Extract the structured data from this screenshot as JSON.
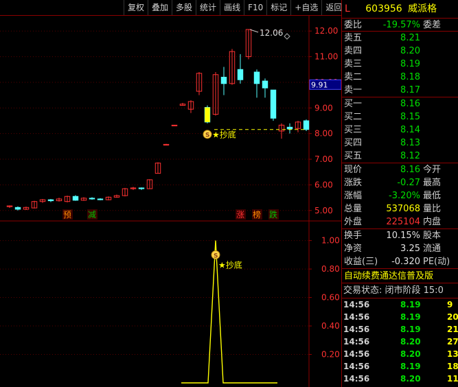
{
  "toolbar": [
    "复权",
    "叠加",
    "多股",
    "统计",
    "画线",
    "F10",
    "标记",
    "+自选",
    "返回"
  ],
  "stock": {
    "market": "L",
    "code": "603956",
    "name": "威派格"
  },
  "weibi": {
    "label": "委比",
    "value": "-19.57%",
    "label2": "委差"
  },
  "asks": [
    {
      "label": "卖五",
      "price": "8.21"
    },
    {
      "label": "卖四",
      "price": "8.20"
    },
    {
      "label": "卖三",
      "price": "8.19"
    },
    {
      "label": "卖二",
      "price": "8.18"
    },
    {
      "label": "卖一",
      "price": "8.17"
    }
  ],
  "bids": [
    {
      "label": "买一",
      "price": "8.16"
    },
    {
      "label": "买二",
      "price": "8.15"
    },
    {
      "label": "买三",
      "price": "8.14"
    },
    {
      "label": "买四",
      "price": "8.13"
    },
    {
      "label": "买五",
      "price": "8.12"
    }
  ],
  "quote": [
    {
      "label": "现价",
      "value": "8.16",
      "label2": "今开",
      "cls": "green"
    },
    {
      "label": "涨跌",
      "value": "-0.27",
      "label2": "最高",
      "cls": "green"
    },
    {
      "label": "涨幅",
      "value": "-3.20%",
      "label2": "最低",
      "cls": "green"
    },
    {
      "label": "总量",
      "value": "537068",
      "label2": "量比",
      "cls": "yellow"
    },
    {
      "label": "外盘",
      "value": "225104",
      "label2": "内盘",
      "cls": "red"
    }
  ],
  "finance": [
    {
      "label": "换手",
      "value": "10.15%",
      "label2": "股本"
    },
    {
      "label": "净资",
      "value": "3.25",
      "label2": "流通"
    },
    {
      "label": "收益(三)",
      "value": "-0.320",
      "label2": "PE(动)"
    }
  ],
  "banner": "自动续费通达信普及版",
  "trade_state": "交易状态: 闭市阶段 15:0",
  "ticks": [
    {
      "time": "14:56",
      "price": "8.19",
      "vol": "9"
    },
    {
      "time": "14:56",
      "price": "8.19",
      "vol": "20"
    },
    {
      "time": "14:56",
      "price": "8.19",
      "vol": "21"
    },
    {
      "time": "14:56",
      "price": "8.20",
      "vol": "27"
    },
    {
      "time": "14:56",
      "price": "8.20",
      "vol": "13"
    },
    {
      "time": "14:56",
      "price": "8.19",
      "vol": "18"
    },
    {
      "time": "14:56",
      "price": "8.20",
      "vol": "11"
    }
  ],
  "chart_data": [
    {
      "type": "candlestick",
      "y_axis_ticks": [
        "12.00",
        "11.00",
        "10.00",
        "9.00",
        "8.00",
        "7.00",
        "6.00",
        "5.00"
      ],
      "ylim": [
        4.7,
        12.3
      ],
      "current_price_label": "9.91",
      "max_annotation": "12.06",
      "signal_label": "★抄底",
      "signal_icon": "S",
      "event_markers": [
        {
          "text": "预",
          "color": "#ff8c00",
          "at": 7
        },
        {
          "text": "减",
          "color": "#00c000",
          "at": 10
        },
        {
          "text": "涨",
          "color": "#ff3232",
          "at": 28
        },
        {
          "text": "榜",
          "color": "#ff8c00",
          "at": 30
        },
        {
          "text": "跌",
          "color": "#00c000",
          "at": 32
        }
      ],
      "candles": [
        [
          5.15,
          5.18,
          5.1,
          5.2
        ],
        [
          5.12,
          5.05,
          5.0,
          5.16
        ],
        [
          5.05,
          5.12,
          5.02,
          5.15
        ],
        [
          5.1,
          5.35,
          5.08,
          5.38
        ],
        [
          5.35,
          5.42,
          5.3,
          5.45
        ],
        [
          5.42,
          5.38,
          5.33,
          5.45
        ],
        [
          5.38,
          5.45,
          5.35,
          5.5
        ],
        [
          5.35,
          5.55,
          5.32,
          5.58
        ],
        [
          5.55,
          5.4,
          5.38,
          5.6
        ],
        [
          5.4,
          5.48,
          5.38,
          5.52
        ],
        [
          5.48,
          5.45,
          5.42,
          5.52
        ],
        [
          5.45,
          5.42,
          5.4,
          5.48
        ],
        [
          5.42,
          5.52,
          5.4,
          5.55
        ],
        [
          5.52,
          5.58,
          5.5,
          5.62
        ],
        [
          5.58,
          5.85,
          5.55,
          5.88
        ],
        [
          5.85,
          5.88,
          5.8,
          5.92
        ],
        [
          5.88,
          5.85,
          5.8,
          5.9
        ],
        [
          5.85,
          6.2,
          5.85,
          6.22
        ],
        [
          6.45,
          6.85,
          6.45,
          6.88
        ],
        [
          7.55,
          7.58,
          7.55,
          7.6
        ],
        [
          8.3,
          8.33,
          8.3,
          8.34
        ],
        [
          9.1,
          9.15,
          9.1,
          9.2
        ],
        [
          8.95,
          9.25,
          8.8,
          9.3
        ],
        [
          9.65,
          10.35,
          9.5,
          10.4
        ],
        [
          9.02,
          8.45,
          8.4,
          9.1
        ],
        [
          8.75,
          10.3,
          8.7,
          10.4
        ],
        [
          10.2,
          9.95,
          9.5,
          10.6
        ],
        [
          9.95,
          11.2,
          9.9,
          11.3
        ],
        [
          10.5,
          10.1,
          9.95,
          11.1
        ],
        [
          11.0,
          12.06,
          10.9,
          12.06
        ],
        [
          10.4,
          9.95,
          9.4,
          10.5
        ],
        [
          10.05,
          9.78,
          9.4,
          10.15
        ],
        [
          9.7,
          8.6,
          8.5,
          9.7
        ],
        [
          8.1,
          8.33,
          7.8,
          8.4
        ],
        [
          8.25,
          8.18,
          8.0,
          8.4
        ],
        [
          8.2,
          8.45,
          8.05,
          8.5
        ],
        [
          8.5,
          8.16,
          8.1,
          8.55
        ]
      ]
    },
    {
      "type": "line",
      "y_axis_ticks": [
        "1.00",
        "0.80",
        "0.60",
        "0.40",
        "0.20"
      ],
      "ylim": [
        0,
        1.08
      ],
      "signal_label": "★抄底",
      "signal_icon": "S",
      "values": [
        0,
        0,
        0,
        0,
        0,
        0,
        0,
        0,
        0,
        0,
        0,
        0,
        0,
        0,
        0,
        0,
        0,
        0,
        0,
        0,
        0,
        0,
        0,
        0,
        0,
        1,
        0,
        0,
        0,
        0,
        0,
        0,
        0,
        0,
        0,
        0,
        0
      ]
    }
  ]
}
